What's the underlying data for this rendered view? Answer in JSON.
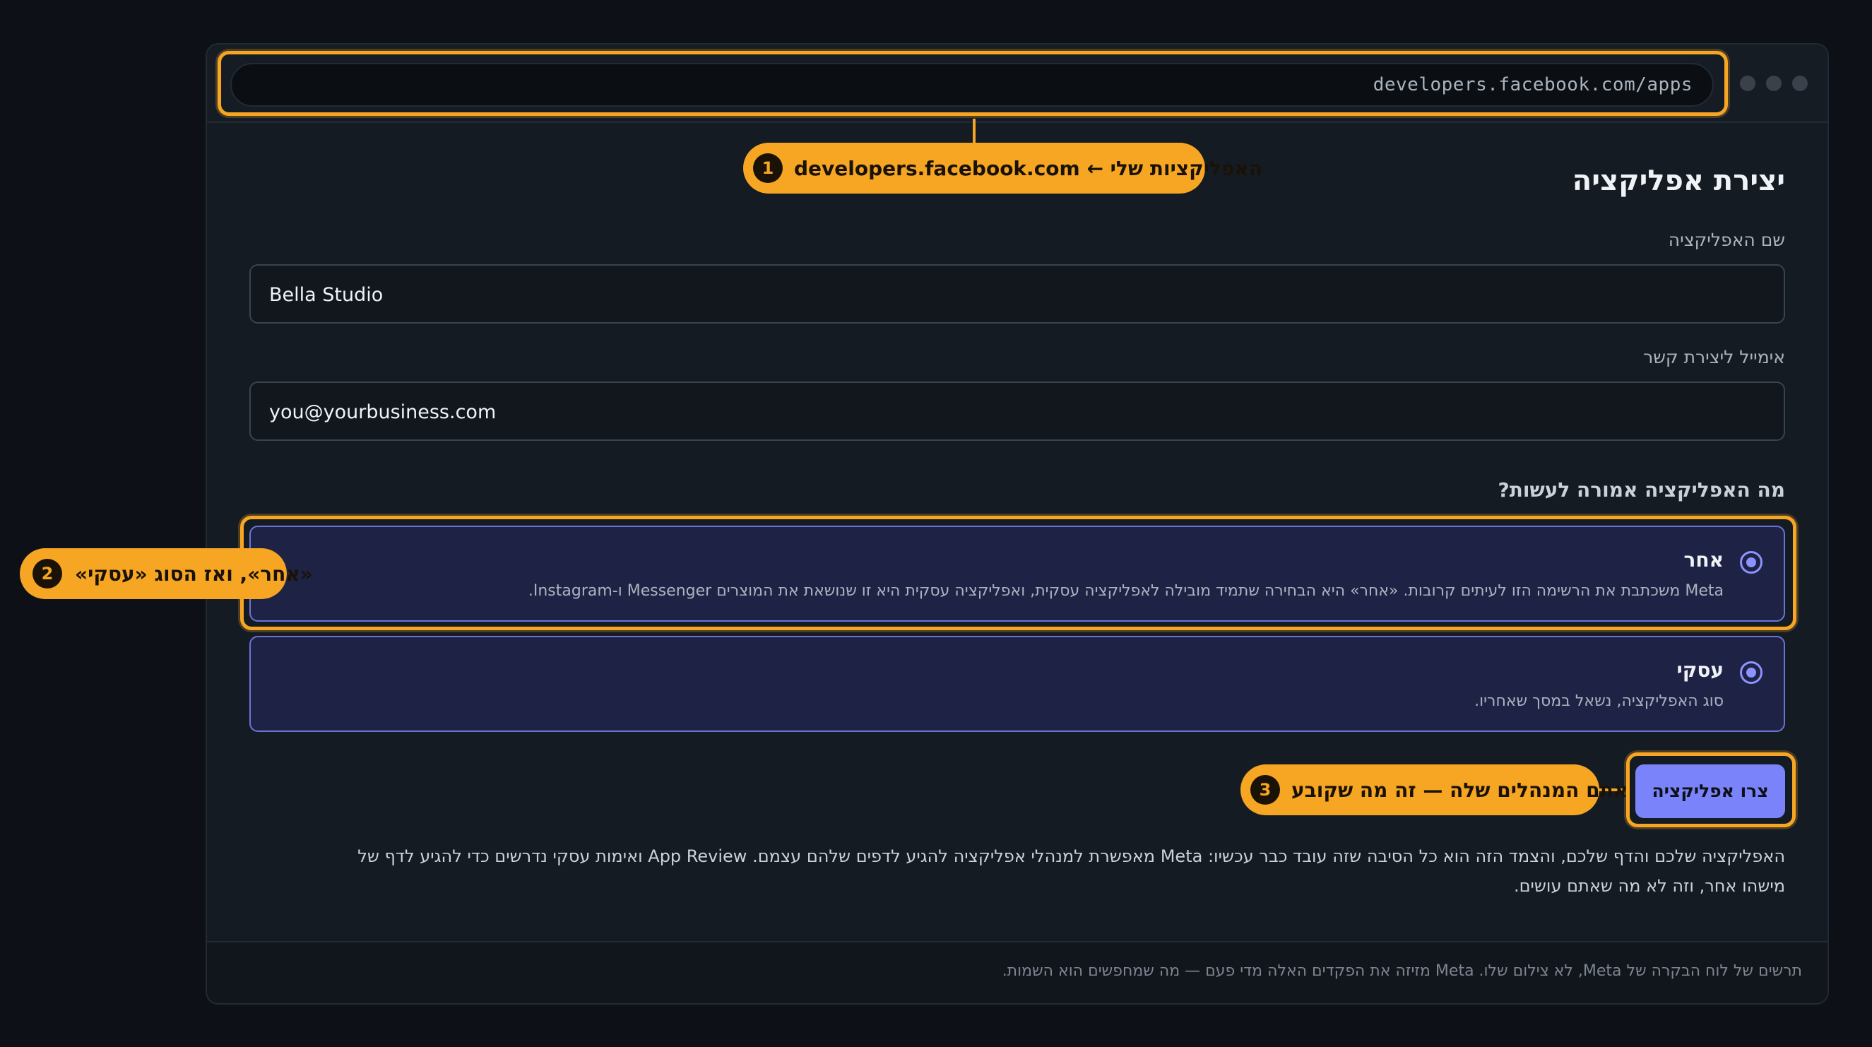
{
  "browser": {
    "url": "developers.facebook.com/apps"
  },
  "form": {
    "title": "יצירת אפליקציה",
    "app_name_label": "שם האפליקציה",
    "app_name_value": "Bella Studio",
    "email_label": "אימייל ליצירת קשר",
    "email_value": "you@yourbusiness.com",
    "question": "מה האפליקציה אמורה לעשות?",
    "options": [
      {
        "title": "אחר",
        "desc": "Meta משכתבת את הרשימה הזו לעיתים קרובות. «אחר» היא הבחירה שתמיד מובילה לאפליקציה עסקית, ואפליקציה עסקית היא זו שנושאת את המוצרים Messenger ו-Instagram."
      },
      {
        "title": "עסקי",
        "desc": "סוג האפליקציה, נשאל במסך שאחריו."
      }
    ],
    "create_button": "צרו אפליקציה",
    "note": "האפליקציה שלכם והדף שלכם, והצמד הזה הוא כל הסיבה שזה עובד כבר עכשיו: Meta מאפשרת למנהלי אפליקציה להגיע לדפים שלהם עצמם. App Review ואימות עסקי נדרשים כדי להגיע לדף של מישהו אחר, וזה לא מה שאתם עושים."
  },
  "footer": {
    "text": "תרשים של לוח הבקרה של Meta, לא צילום שלו. Meta מזיזה את הפקדים האלה מדי פעם — מה שמחפשים הוא השמות."
  },
  "annotations": [
    {
      "number": "1",
      "text": "האפליקציות שלי ← developers.facebook.com"
    },
    {
      "number": "2",
      "text": "«אחר», ואז הסוג «עסקי»"
    },
    {
      "number": "3",
      "text": "אתם המנהלים שלה — זה מה שקובע"
    }
  ],
  "colors": {
    "accent": "#f6a623",
    "primary": "#7b83fb",
    "background": "#0d1117"
  }
}
